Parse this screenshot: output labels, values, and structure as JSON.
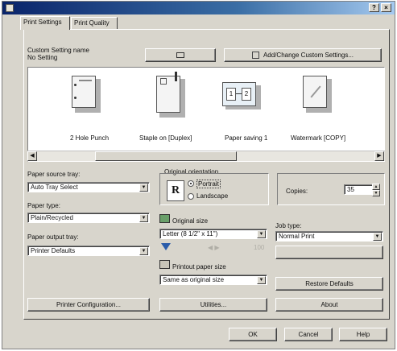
{
  "window": {
    "title_buttons": [
      "?",
      "×"
    ]
  },
  "tabs": [
    {
      "label": "Print Settings",
      "active": true
    },
    {
      "label": "Print Quality",
      "active": false
    }
  ],
  "custom_setting": {
    "name_label": "Custom Setting name",
    "value": "No Setting",
    "add_change_label": "Add/Change Custom Settings..."
  },
  "preview_items": [
    {
      "caption": "2 Hole Punch",
      "icon": "hole-punch-icon"
    },
    {
      "caption": "Staple on [Duplex]",
      "icon": "staple-icon"
    },
    {
      "caption": "Paper saving 1",
      "icon": "paper-saving-icon"
    },
    {
      "caption": "Watermark [COPY]",
      "icon": "watermark-icon"
    }
  ],
  "left_column": {
    "paper_source_label": "Paper source tray:",
    "paper_source_value": "Auto Tray Select",
    "paper_type_label": "Paper type:",
    "paper_type_value": "Plain/Recycled",
    "paper_output_label": "Paper output tray:",
    "paper_output_value": "Printer Defaults"
  },
  "orientation": {
    "label": "Original orientation",
    "icon_letter": "R",
    "portrait": "Portrait",
    "landscape": "Landscape",
    "selected": "Portrait"
  },
  "copies": {
    "label": "Copies:",
    "value": "35"
  },
  "original_size": {
    "label": "Original size",
    "value": "Letter (8 1/2\" x 11\")",
    "disabled_text": "100"
  },
  "printout_size": {
    "label": "Printout paper size",
    "value": "Same as original size"
  },
  "job_type": {
    "label": "Job type:",
    "value": "Normal Print"
  },
  "buttons": {
    "restore_defaults": "Restore Defaults",
    "printer_configuration": "Printer Configuration...",
    "utilities": "Utilities...",
    "about": "About",
    "ok": "OK",
    "cancel": "Cancel",
    "help": "Help"
  }
}
